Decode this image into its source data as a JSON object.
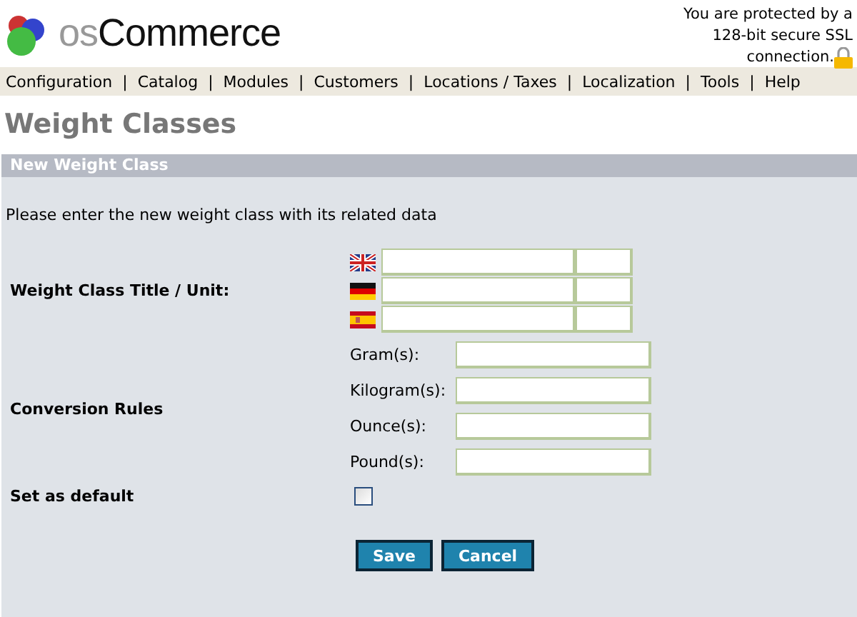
{
  "header": {
    "logo_prefix": "os",
    "logo_name": "Commerce",
    "ssl_notice": [
      "You are protected by a",
      "128-bit secure SSL",
      "connection."
    ]
  },
  "nav_separator": "|",
  "nav": [
    "Configuration",
    "Catalog",
    "Modules",
    "Customers",
    "Locations / Taxes",
    "Localization",
    "Tools",
    "Help"
  ],
  "page_title": "Weight Classes",
  "panel": {
    "title": "New Weight Class",
    "intro": "Please enter the new weight class with its related data",
    "title_label": "Weight Class Title / Unit:",
    "languages": [
      {
        "kind": "uk"
      },
      {
        "kind": "de"
      },
      {
        "kind": "es"
      }
    ],
    "conversion_label": "Conversion Rules",
    "conversions": [
      "Gram(s):",
      "Kilogram(s):",
      "Ounce(s):",
      "Pound(s):"
    ],
    "default_label": "Set as default",
    "default_checked": false,
    "buttons": [
      "Save",
      "Cancel"
    ]
  }
}
